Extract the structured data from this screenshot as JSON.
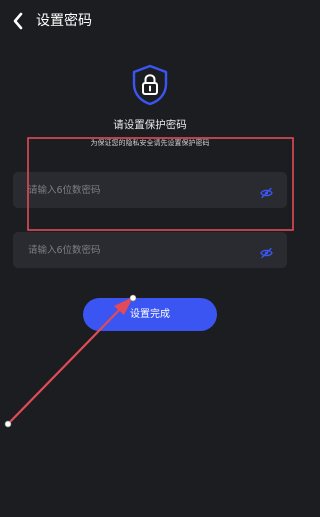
{
  "header": {
    "back_icon": "chevron-left-icon",
    "title": "设置密码"
  },
  "hero": {
    "icon": "shield-lock-icon",
    "prompt": "请设置保护密码",
    "subprompt": "为保证您的隐私安全请先设置保护密码"
  },
  "form": {
    "password": {
      "placeholder": "请输入6位数密码",
      "value": "",
      "toggle_icon": "eye-icon"
    },
    "confirm_password": {
      "placeholder": "请输入6位数密码",
      "value": "",
      "toggle_icon": "eye-icon"
    },
    "submit_label": "设置完成"
  },
  "colors": {
    "background": "#1c1d21",
    "field_background": "#2a2b30",
    "accent": "#3b55f2",
    "annotation": "#e24b55"
  }
}
